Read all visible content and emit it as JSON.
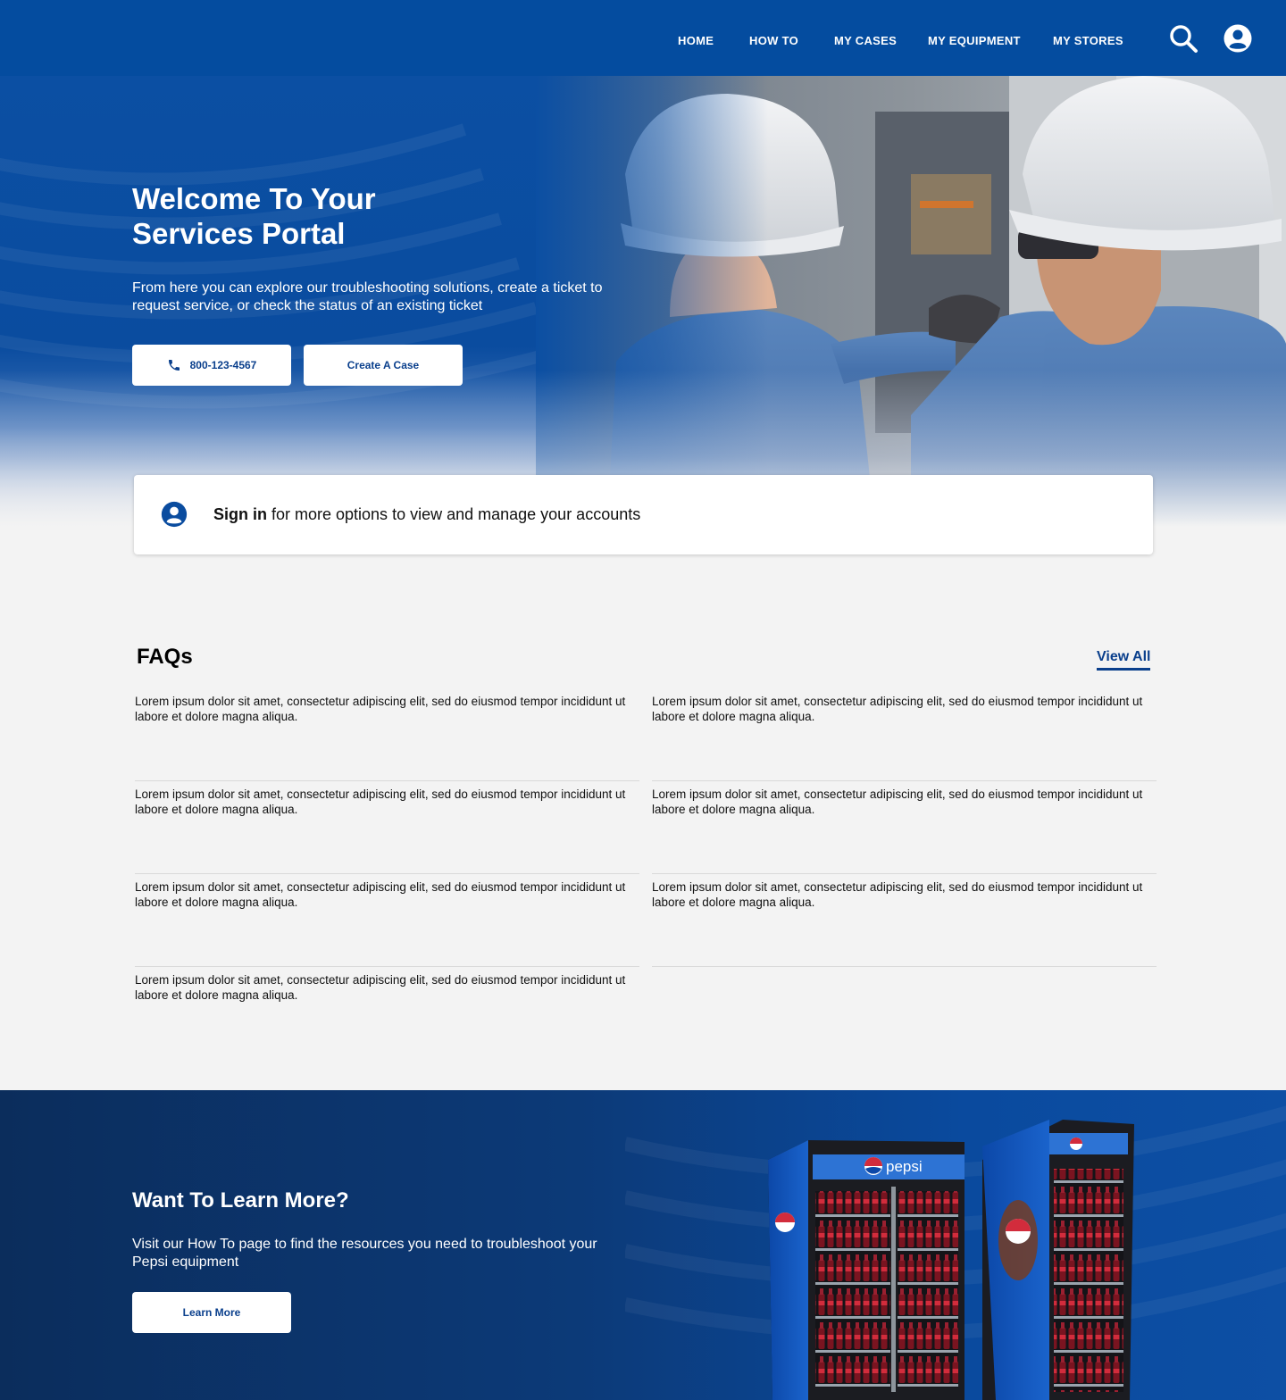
{
  "nav": {
    "items": [
      {
        "label": "HOME"
      },
      {
        "label": "HOW TO"
      },
      {
        "label": "MY CASES"
      },
      {
        "label": "MY EQUIPMENT"
      },
      {
        "label": "MY STORES"
      }
    ],
    "icons": [
      "search-icon",
      "account-icon"
    ]
  },
  "hero": {
    "title_line1": "Welcome To Your",
    "title_line2": "Services Portal",
    "subtitle": "From here you can explore our troubleshooting solutions, create a ticket to request service, or check the status of an existing ticket",
    "phone_label": "800-123-4567",
    "case_label": "Create A Case"
  },
  "signin": {
    "link": "Sign in",
    "text": " for more options to view and manage your accounts"
  },
  "faq": {
    "title": "FAQs",
    "view_all": "View All",
    "items": [
      "Lorem ipsum dolor sit amet, consectetur adipiscing elit, sed do eiusmod tempor incididunt ut labore et dolore magna aliqua.",
      "Lorem ipsum dolor sit amet, consectetur adipiscing elit, sed do eiusmod tempor incididunt ut labore et dolore magna aliqua.",
      "Lorem ipsum dolor sit amet, consectetur adipiscing elit, sed do eiusmod tempor incididunt ut labore et dolore magna aliqua.",
      "Lorem ipsum dolor sit amet, consectetur adipiscing elit, sed do eiusmod tempor incididunt ut labore et dolore magna aliqua.",
      "Lorem ipsum dolor sit amet, consectetur adipiscing elit, sed do eiusmod tempor incididunt ut labore et dolore magna aliqua.",
      "Lorem ipsum dolor sit amet, consectetur adipiscing elit, sed do eiusmod tempor incididunt ut labore et dolore magna aliqua.",
      "Lorem ipsum dolor sit amet, consectetur adipiscing elit, sed do eiusmod tempor incididunt ut labore et dolore magna aliqua."
    ]
  },
  "learn": {
    "title": "Want To Learn More?",
    "subtitle": "Visit our How To page to find the resources you need to troubleshoot your Pepsi equipment",
    "button": "Learn More",
    "brand_text": "pepsi"
  },
  "colors": {
    "brand_blue": "#044c9f",
    "dark_navy": "#0b2d5c",
    "button_text": "#0a3f8c",
    "background": "#f3f3f3"
  }
}
